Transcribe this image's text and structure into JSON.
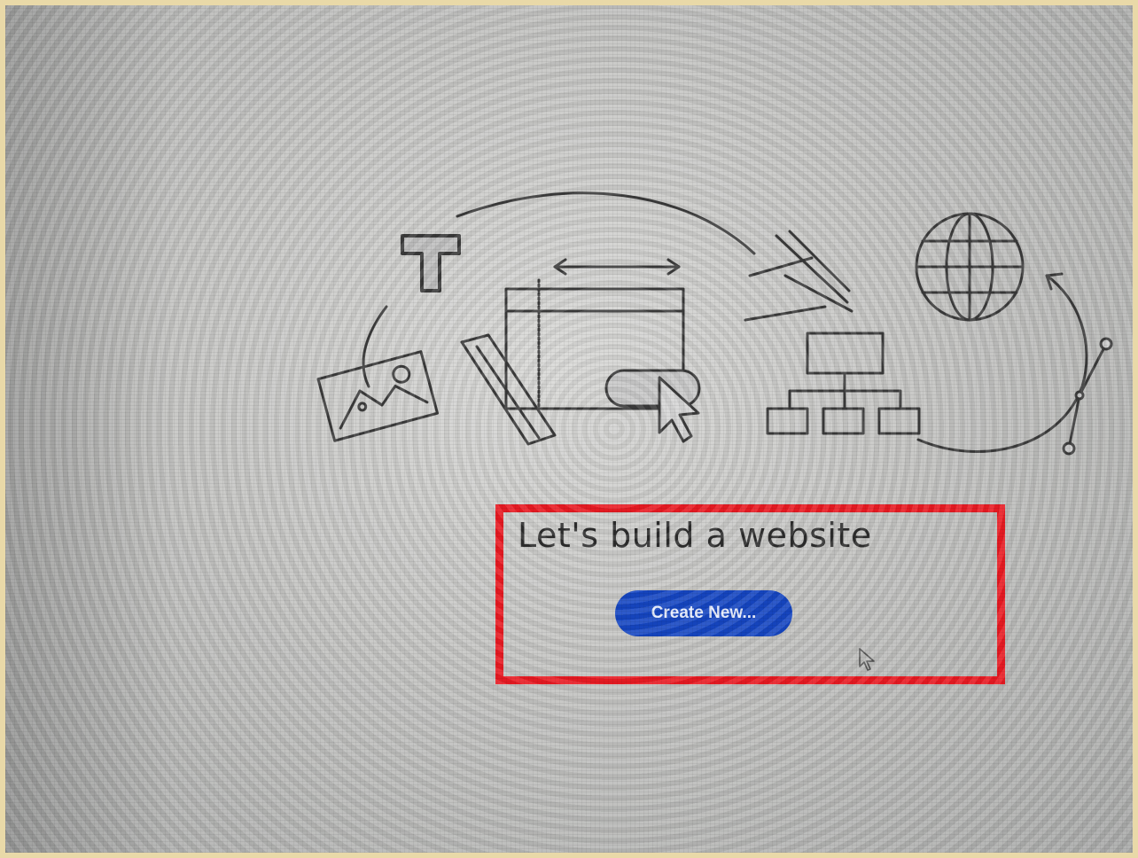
{
  "welcome": {
    "headline": "Let's build a website",
    "create_button_label": "Create New..."
  },
  "icons": [
    "text-tool-icon",
    "image-icon",
    "pen-tool-icon",
    "layout-icon",
    "button-cursor-icon",
    "gesture-lines-icon",
    "sitemap-icon",
    "globe-icon",
    "bezier-curve-icon",
    "mouse-cursor-icon"
  ],
  "colors": {
    "highlight": "#ec1b23",
    "button": "#1647c4",
    "text": "#2d2d2d"
  }
}
